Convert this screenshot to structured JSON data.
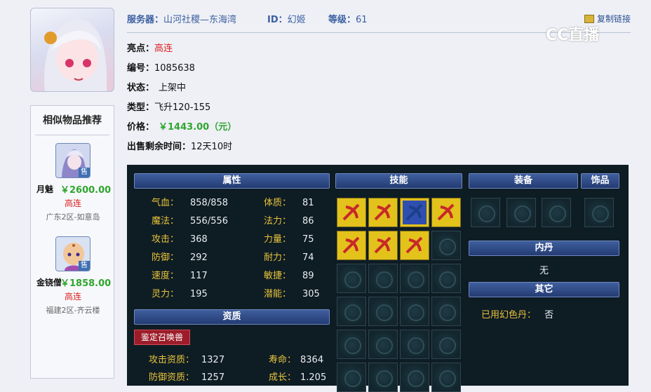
{
  "header": {
    "server_label": "服务器：",
    "server_value": "山河社稷—东海湾",
    "id_label": "ID：",
    "id_value": "幻姬",
    "level_label": "等级：",
    "level_value": "61",
    "copy_link": "复制链接"
  },
  "watermark": "CC直播",
  "info": {
    "highlight_label": "亮点：",
    "highlight_value": "高连",
    "serial_label": "编号：",
    "serial_value": "1085638",
    "status_label": "状态：",
    "status_value": "上架中",
    "type_label": "类型：",
    "type_value": "飞升120-155",
    "price_label": "价格：",
    "price_value": "￥1443.00（元）",
    "time_label": "出售剩余时间：",
    "time_value": "12天10时"
  },
  "recommend": {
    "title": "相似物品推荐",
    "items": [
      {
        "name": "月魅",
        "price": "￥2600.00",
        "tag": "高连",
        "server": "广东2区-如意岛",
        "badge": "售"
      },
      {
        "name": "金铙僧",
        "price": "￥1858.00",
        "tag": "高连",
        "server": "福建2区-齐云楼",
        "badge": "售"
      }
    ]
  },
  "panel": {
    "attr_head": "属性",
    "skill_head": "技能",
    "equip_head": "装备",
    "ornament_head": "饰品",
    "neidan_head": "内丹",
    "neidan_value": "无",
    "other_head": "其它",
    "huanse_label": "已用幻色丹：",
    "huanse_value": "否",
    "aptitude_head": "资质",
    "appraise_button": "鉴定召唤兽",
    "attrs": [
      {
        "k": "气血：",
        "v": "858/858"
      },
      {
        "k": "体质：",
        "v": "81"
      },
      {
        "k": "魔法：",
        "v": "556/556"
      },
      {
        "k": "法力：",
        "v": "86"
      },
      {
        "k": "攻击：",
        "v": "368"
      },
      {
        "k": "力量：",
        "v": "75"
      },
      {
        "k": "防御：",
        "v": "292"
      },
      {
        "k": "耐力：",
        "v": "74"
      },
      {
        "k": "速度：",
        "v": "117"
      },
      {
        "k": "敏捷：",
        "v": "89"
      },
      {
        "k": "灵力：",
        "v": "195"
      },
      {
        "k": "潜能：",
        "v": "305"
      }
    ],
    "aptitudes": [
      {
        "k": "攻击资质：",
        "v": "1327"
      },
      {
        "k": "寿命：",
        "v": "8364"
      },
      {
        "k": "防御资质：",
        "v": "1257"
      },
      {
        "k": "成长：",
        "v": "1.205"
      }
    ]
  }
}
